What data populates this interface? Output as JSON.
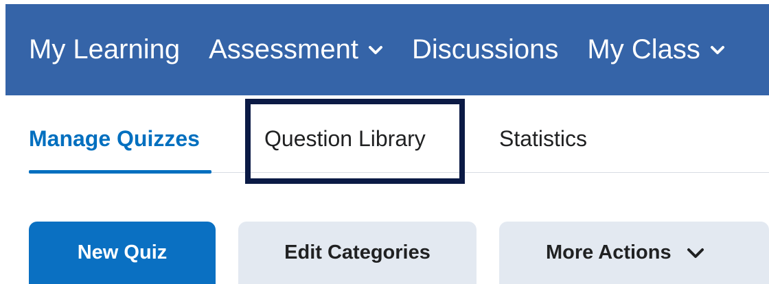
{
  "topnav": {
    "items": [
      {
        "label": "My Learning",
        "has_dropdown": false
      },
      {
        "label": "Assessment",
        "has_dropdown": true
      },
      {
        "label": "Discussions",
        "has_dropdown": false
      },
      {
        "label": "My Class",
        "has_dropdown": true
      }
    ]
  },
  "tabs": {
    "items": [
      {
        "label": "Manage Quizzes",
        "active": true
      },
      {
        "label": "Question Library",
        "active": false,
        "highlighted": true
      },
      {
        "label": "Statistics",
        "active": false
      }
    ]
  },
  "toolbar": {
    "new_quiz_label": "New Quiz",
    "edit_categories_label": "Edit Categories",
    "more_actions_label": "More Actions"
  },
  "colors": {
    "nav_bg": "#3564a8",
    "active_tab": "#006fbf",
    "primary_button": "#0a70c2",
    "secondary_button": "#e3e9f1",
    "highlight_border": "#0b1a45"
  }
}
